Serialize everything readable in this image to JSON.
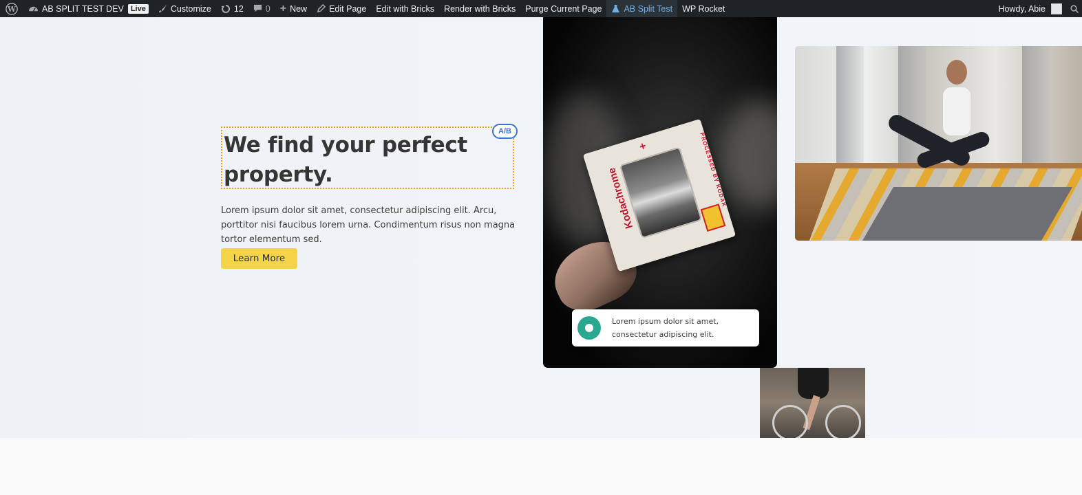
{
  "adminbar": {
    "site_name": "AB SPLIT TEST DEV",
    "live_label": "Live",
    "customize": "Customize",
    "updates_count": "12",
    "comments_count": "0",
    "new": "New",
    "edit_page": "Edit Page",
    "edit_with_bricks": "Edit with Bricks",
    "render_with_bricks": "Render with Bricks",
    "purge_current_page": "Purge Current Page",
    "ab_split_test": "AB Split Test",
    "wp_rocket": "WP Rocket",
    "howdy": "Howdy, Abie"
  },
  "hero": {
    "headline": "We find your perfect property.",
    "ab_badge": "A/B",
    "lead": "Lorem ipsum dolor sit amet, consectetur adipiscing elit. Arcu, porttitor nisi faucibus lorem urna. Condimentum risus non magna tortor elementum sed.",
    "button_label": "Learn More"
  },
  "card": {
    "slide_brand": "Kodachrome",
    "slide_sub": "PROCESSED BY KODAK",
    "notification_text": "Lorem ipsum dolor sit amet, consectetur adipiscing elit."
  },
  "colors": {
    "accent_yellow": "#f4d54a",
    "ab_blue": "#3b73c8",
    "dotted_border": "#e2a211",
    "notif_green": "#2aa88f",
    "adminbar_bg": "#1d2327"
  }
}
